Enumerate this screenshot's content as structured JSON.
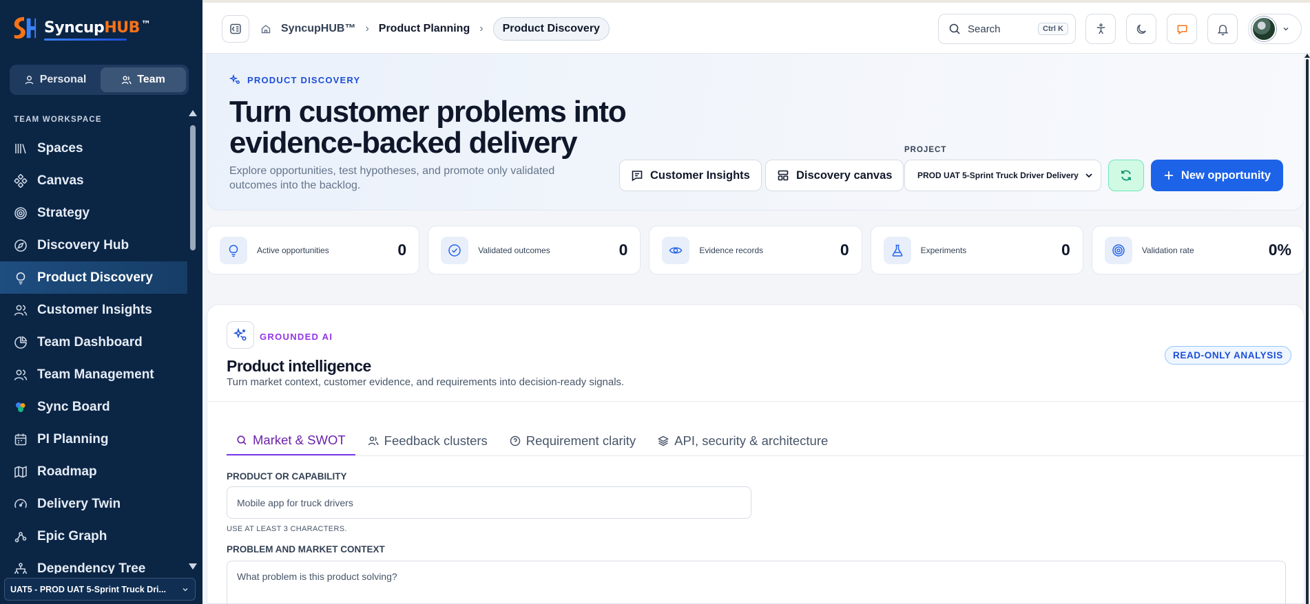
{
  "brand": {
    "name_prefix": "Syncup",
    "name_hub": "HUB",
    "tm": "™"
  },
  "sidebar": {
    "toggle": {
      "personal": "Personal",
      "team": "Team",
      "active": "team"
    },
    "section_label": "TEAM WORKSPACE",
    "items": [
      {
        "label": "Spaces",
        "icon": "library-icon"
      },
      {
        "label": "Canvas",
        "icon": "nodes-icon"
      },
      {
        "label": "Strategy",
        "icon": "target-icon"
      },
      {
        "label": "Discovery Hub",
        "icon": "compass-icon"
      },
      {
        "label": "Product Discovery",
        "icon": "lightbulb-icon",
        "active": true
      },
      {
        "label": "Customer Insights",
        "icon": "users-icon"
      },
      {
        "label": "Team Dashboard",
        "icon": "pie-chart-icon"
      },
      {
        "label": "Team Management",
        "icon": "user-group-icon"
      },
      {
        "label": "Sync Board",
        "icon": "sync-dots-icon"
      },
      {
        "label": "PI Planning",
        "icon": "calendar-icon"
      },
      {
        "label": "Roadmap",
        "icon": "map-icon"
      },
      {
        "label": "Delivery Twin",
        "icon": "gauge-icon"
      },
      {
        "label": "Epic Graph",
        "icon": "graph-icon"
      },
      {
        "label": "Dependency Tree",
        "icon": "tree-icon"
      }
    ],
    "project_switcher": "UAT5 - PROD UAT 5-Sprint Truck Dri..."
  },
  "topbar": {
    "breadcrumbs": [
      "SyncupHUB™",
      "Product Planning",
      "Product Discovery"
    ],
    "search_label": "Search",
    "search_shortcut": "Ctrl K"
  },
  "hero": {
    "eyebrow": "PRODUCT DISCOVERY",
    "title": "Turn customer problems into evidence-backed delivery",
    "subtitle": "Explore opportunities, test hypotheses, and promote only validated outcomes into the backlog.",
    "customer_insights_btn": "Customer Insights",
    "discovery_canvas_btn": "Discovery canvas",
    "project_label": "PROJECT",
    "project_value": "PROD UAT 5-Sprint Truck Driver Delivery",
    "new_opportunity_btn": "New opportunity"
  },
  "stats": [
    {
      "label": "Active opportunities",
      "value": "0",
      "icon": "lightbulb-icon"
    },
    {
      "label": "Validated outcomes",
      "value": "0",
      "icon": "check-circle-icon"
    },
    {
      "label": "Evidence records",
      "value": "0",
      "icon": "eye-icon"
    },
    {
      "label": "Experiments",
      "value": "0",
      "icon": "flask-icon"
    },
    {
      "label": "Validation rate",
      "value": "0%",
      "icon": "target-icon"
    }
  ],
  "intelligence": {
    "eyebrow": "GROUNDED AI",
    "title": "Product intelligence",
    "subtitle": "Turn market context, customer evidence, and requirements into decision-ready signals.",
    "badge": "READ-ONLY ANALYSIS",
    "tabs": [
      {
        "label": "Market & SWOT",
        "active": true
      },
      {
        "label": "Feedback clusters"
      },
      {
        "label": "Requirement clarity"
      },
      {
        "label": "API, security & architecture"
      }
    ],
    "product_label": "PRODUCT OR CAPABILITY",
    "product_placeholder": "Mobile app for truck drivers",
    "product_hint": "USE AT LEAST 3 CHARACTERS.",
    "problem_label": "PROBLEM AND MARKET CONTEXT",
    "problem_placeholder": "What problem is this product solving?"
  },
  "colors": {
    "sidebar_bg": "#0b2545",
    "accent_blue": "#1d63e8",
    "accent_purple": "#7c3aed",
    "hub_orange": "#f97316"
  }
}
